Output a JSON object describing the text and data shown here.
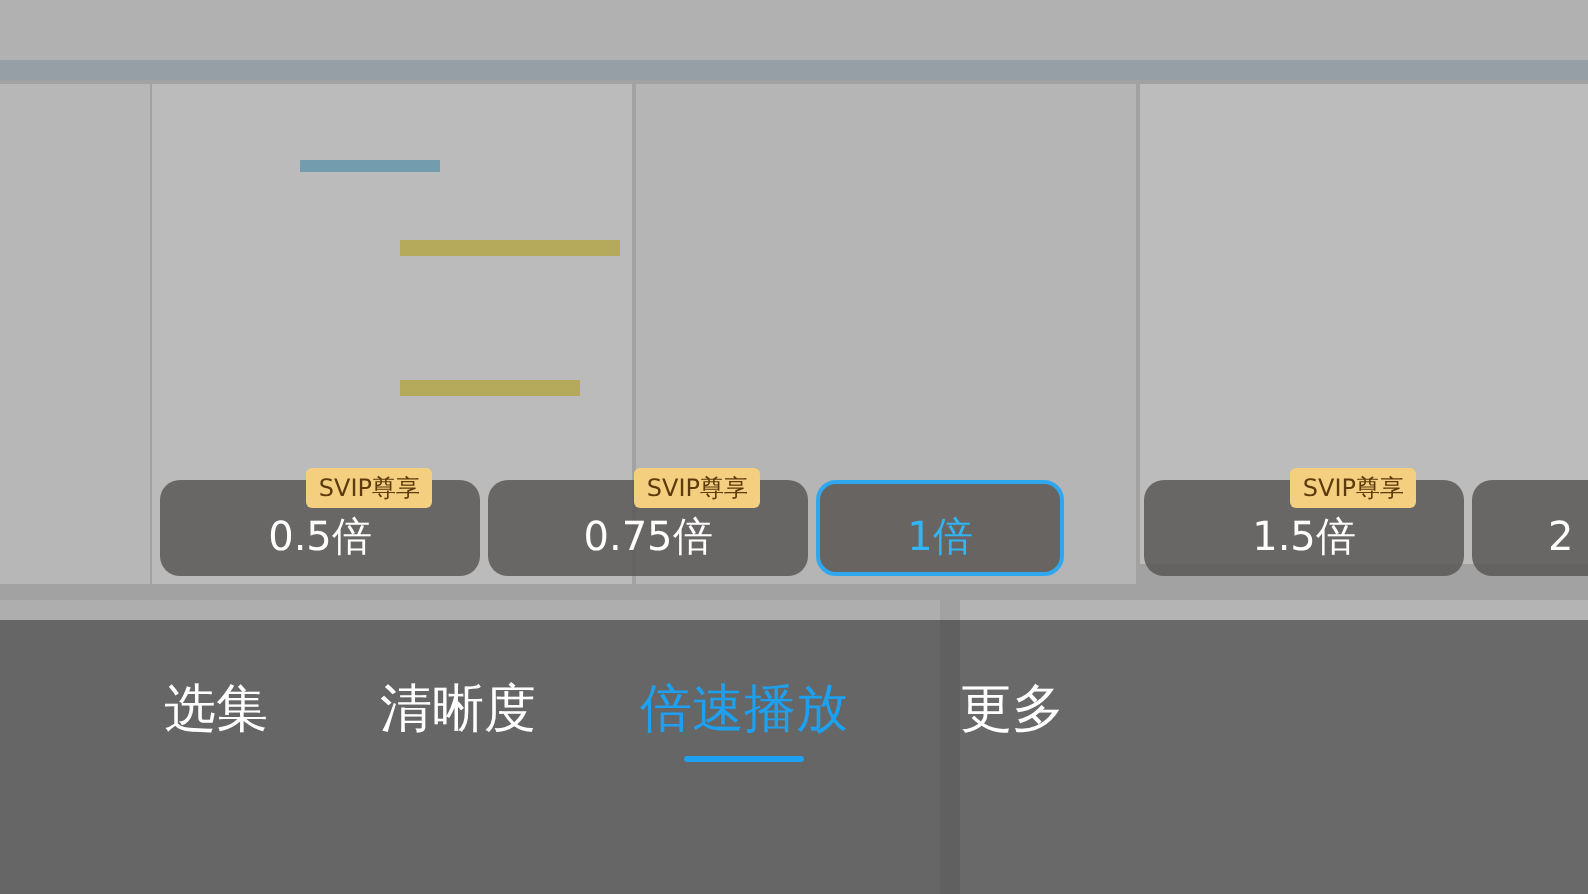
{
  "speeds": [
    {
      "label": "0.5倍",
      "badge": "SVIP尊享",
      "selected": false
    },
    {
      "label": "0.75倍",
      "badge": "SVIP尊享",
      "selected": false
    },
    {
      "label": "1倍",
      "selected": true
    },
    {
      "label": "1.5倍",
      "badge": "SVIP尊享",
      "selected": false
    },
    {
      "label": "2",
      "selected": false
    }
  ],
  "tabs": [
    {
      "label": "选集",
      "selected": false
    },
    {
      "label": "清晰度",
      "selected": false
    },
    {
      "label": "倍速播放",
      "selected": true
    },
    {
      "label": "更多",
      "selected": false
    }
  ]
}
